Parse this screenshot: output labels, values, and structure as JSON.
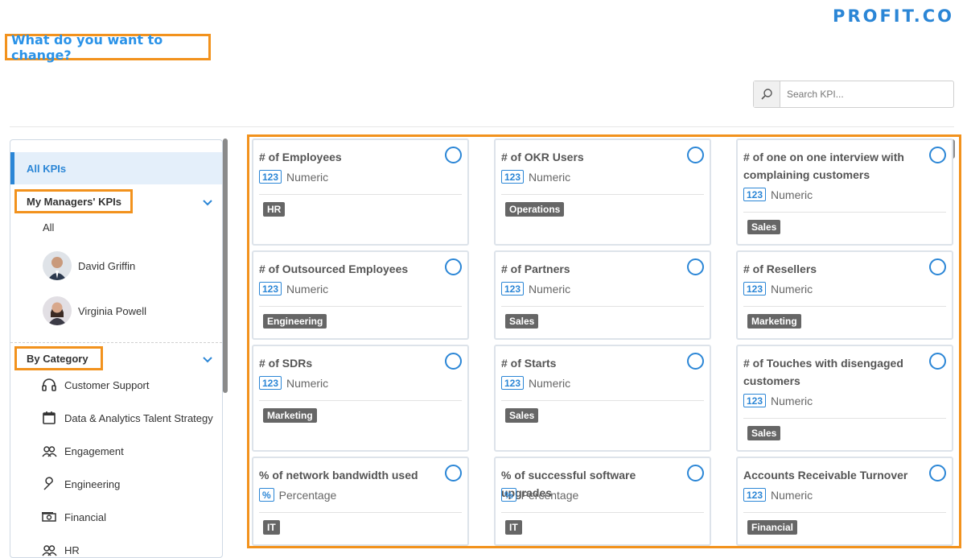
{
  "brand": {
    "logo": "PROFIT.CO"
  },
  "header": {
    "title": "What do you want to change?"
  },
  "search": {
    "placeholder": "Search KPI..."
  },
  "sidebar": {
    "all_kpis": "All KPIs",
    "managers_section": "My Managers' KPIs",
    "all_label": "All",
    "managers": [
      {
        "name": "David Griffin"
      },
      {
        "name": "Virginia Powell"
      }
    ],
    "category_section": "By Category",
    "categories": [
      {
        "label": "Customer Support",
        "icon": "headset-icon"
      },
      {
        "label": "Data & Analytics Talent Strategy",
        "icon": "calendar-icon"
      },
      {
        "label": "Engagement",
        "icon": "people-icon"
      },
      {
        "label": "Engineering",
        "icon": "wrench-icon"
      },
      {
        "label": "Financial",
        "icon": "money-icon"
      },
      {
        "label": "HR",
        "icon": "people-icon"
      }
    ]
  },
  "kpis": [
    {
      "title": "# of Employees",
      "type_badge": "123",
      "type": "Numeric",
      "tag": "HR"
    },
    {
      "title": "# of OKR Users",
      "type_badge": "123",
      "type": "Numeric",
      "tag": "Operations"
    },
    {
      "title": "# of one on one interview with complaining customers",
      "type_badge": "123",
      "type": "Numeric",
      "tag": "Sales"
    },
    {
      "title": "# of Outsourced Employees",
      "type_badge": "123",
      "type": "Numeric",
      "tag": "Engineering"
    },
    {
      "title": "# of Partners",
      "type_badge": "123",
      "type": "Numeric",
      "tag": "Sales"
    },
    {
      "title": "# of Resellers",
      "type_badge": "123",
      "type": "Numeric",
      "tag": "Marketing"
    },
    {
      "title": "# of SDRs",
      "type_badge": "123",
      "type": "Numeric",
      "tag": "Marketing"
    },
    {
      "title": "# of Starts",
      "type_badge": "123",
      "type": "Numeric",
      "tag": "Sales"
    },
    {
      "title": "# of Touches with disengaged customers",
      "type_badge": "123",
      "type": "Numeric",
      "tag": "Sales"
    },
    {
      "title": "% of network bandwidth used",
      "type_badge": "%",
      "type": "Percentage",
      "tag": "IT"
    },
    {
      "title": "% of successful software upgrades",
      "type_badge": "%",
      "type": "Percentage",
      "tag": "IT"
    },
    {
      "title": "Accounts Receivable Turnover",
      "type_badge": "123",
      "type": "Numeric",
      "tag": "Financial"
    }
  ],
  "colors": {
    "accent": "#2b86d6",
    "highlight": "#f2921d",
    "tag_bg": "#666666"
  }
}
